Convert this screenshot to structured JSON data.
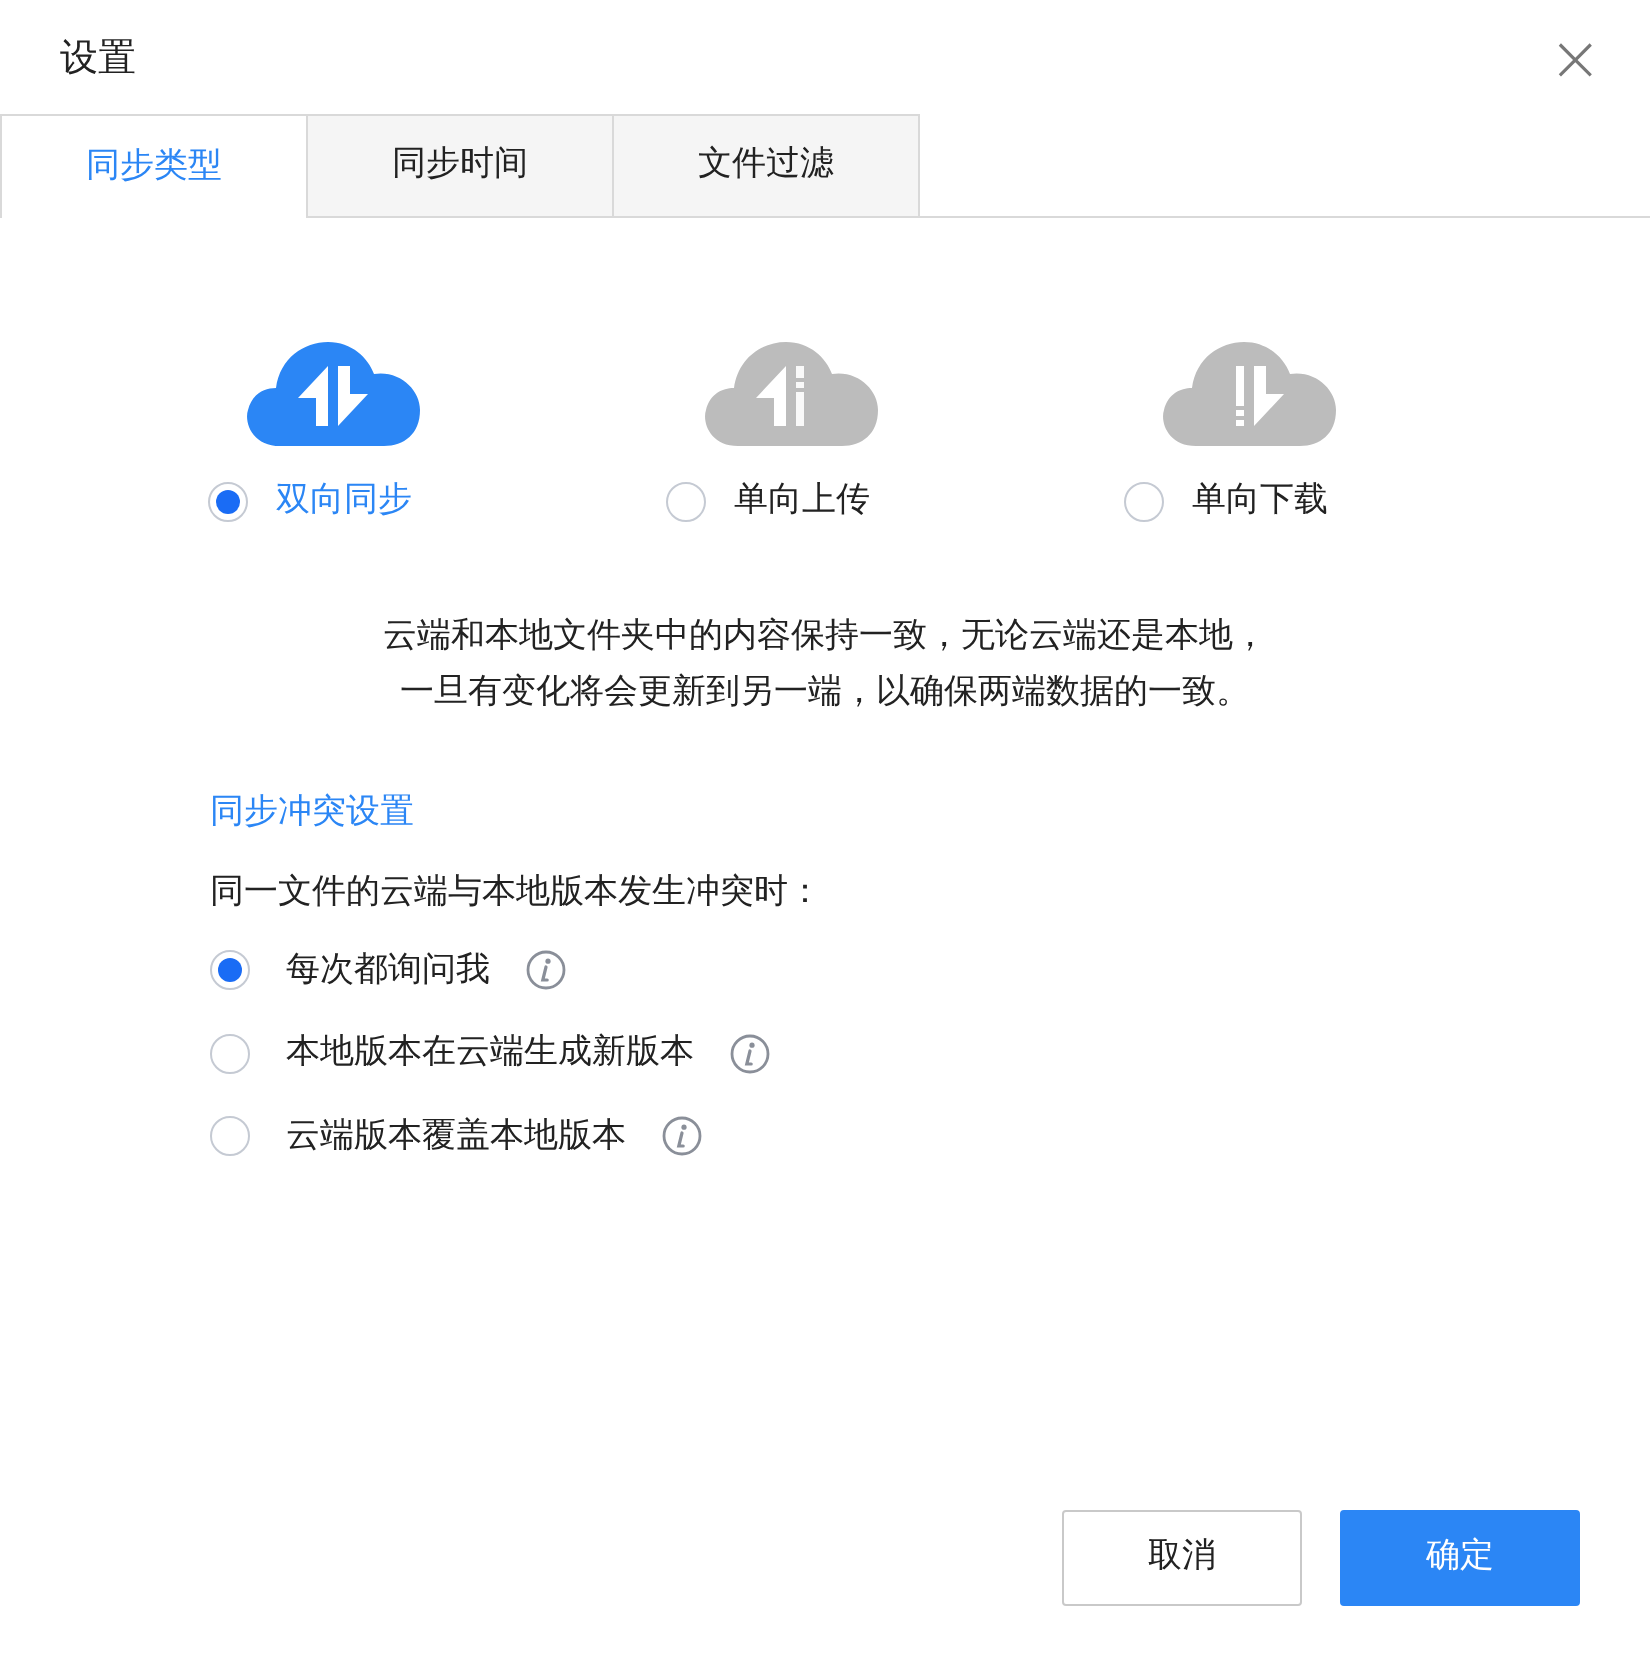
{
  "dialog": {
    "title": "设置",
    "close": "×"
  },
  "tabs": [
    {
      "label": "同步类型",
      "selected": true
    },
    {
      "label": "同步时间",
      "selected": false
    },
    {
      "label": "文件过滤",
      "selected": false
    }
  ],
  "sync_modes": [
    {
      "kind": "both",
      "label": "双向同步",
      "selected": true
    },
    {
      "kind": "upload",
      "label": "单向上传",
      "selected": false
    },
    {
      "kind": "download",
      "label": "单向下载",
      "selected": false
    }
  ],
  "description": [
    "云端和本地文件夹中的内容保持一致，无论云端还是本地，",
    "一旦有变化将会更新到另一端，以确保两端数据的一致。"
  ],
  "conflict": {
    "heading": "同步冲突设置",
    "question": "同一文件的云端与本地版本发生冲突时：",
    "options": [
      {
        "label": "每次都询问我",
        "selected": true
      },
      {
        "label": "本地版本在云端生成新版本",
        "selected": false
      },
      {
        "label": "云端版本覆盖本地版本",
        "selected": false
      }
    ]
  },
  "buttons": [
    {
      "kind": "secondary",
      "label": "取消"
    },
    {
      "kind": "primary",
      "label": "确定"
    }
  ]
}
